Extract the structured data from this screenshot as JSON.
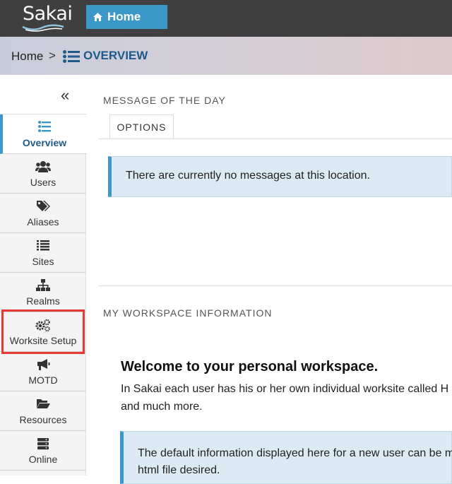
{
  "topbar": {
    "logo_text": "Sakai",
    "home_tab": "Home"
  },
  "breadcrumb": {
    "home": "Home",
    "separator": ">",
    "current": "OVERVIEW"
  },
  "sidebar": {
    "collapse_glyph": "«",
    "items": [
      {
        "label": "Overview",
        "icon": "list-icon",
        "active": true
      },
      {
        "label": "Users",
        "icon": "users-icon"
      },
      {
        "label": "Aliases",
        "icon": "tags-icon"
      },
      {
        "label": "Sites",
        "icon": "list-icon"
      },
      {
        "label": "Realms",
        "icon": "sitemap-icon"
      },
      {
        "label": "Worksite Setup",
        "icon": "cogs-icon"
      },
      {
        "label": "MOTD",
        "icon": "bullhorn-icon"
      },
      {
        "label": "Resources",
        "icon": "folder-open-icon"
      },
      {
        "label": "Online",
        "icon": "server-icon"
      }
    ]
  },
  "motd": {
    "title": "MESSAGE OF THE DAY",
    "options_tab": "OPTIONS",
    "message": "There are currently no messages at this location."
  },
  "workspace": {
    "title": "MY WORKSPACE INFORMATION",
    "heading": "Welcome to your personal workspace.",
    "line1": "In Sakai each user has his or her own individual worksite called H",
    "line2": "and much more.",
    "box_line1": "The default information displayed here for a new user can be m",
    "box_line2": "html file desired."
  },
  "colors": {
    "accent": "#3b98c9",
    "topbar": "#3f3f3f",
    "highlight": "#e53935"
  }
}
